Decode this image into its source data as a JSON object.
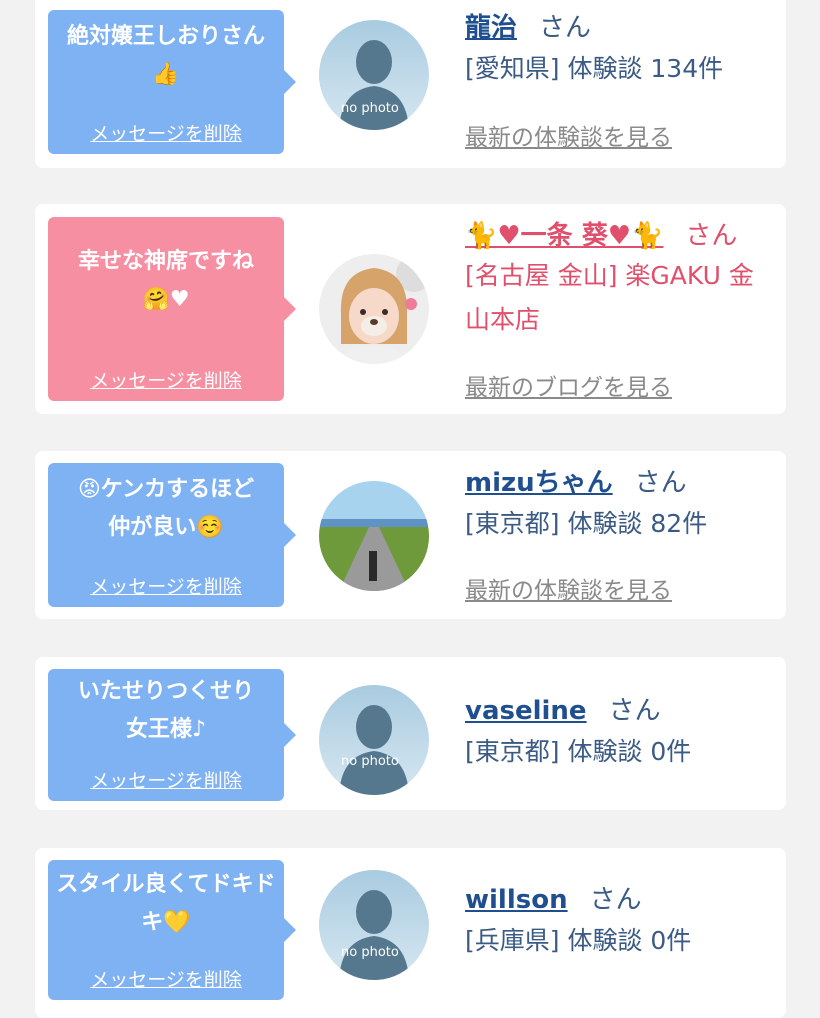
{
  "entries": [
    {
      "message": "絶対嬢王しおりさん👍",
      "delete_label": "メッセージを削除",
      "name": "龍治",
      "honorific": "さん",
      "meta": "[愛知県] 体験談 134件",
      "latest_link": "最新の体験談を見る",
      "avatar_label": "no photo"
    },
    {
      "message": "幸せな神席ですね\n🤗♥",
      "delete_label": "メッセージを削除",
      "name": "🐈♥一条 葵♥🐈",
      "honorific": "さん",
      "meta": "[名古屋 金山] 楽GAKU 金山本店",
      "latest_link": "最新のブログを見る"
    },
    {
      "message": "😡ケンカするほど\n仲が良い☺️",
      "delete_label": "メッセージを削除",
      "name": "mizuちゃん",
      "honorific": "さん",
      "meta": "[東京都] 体験談 82件",
      "latest_link": "最新の体験談を見る"
    },
    {
      "message": "いたせりつくせり\n女王様♪",
      "delete_label": "メッセージを削除",
      "name": "vaseline",
      "honorific": "さん",
      "meta": "[東京都] 体験談 0件",
      "avatar_label": "no photo"
    },
    {
      "message": "スタイル良くてドキドキ💛",
      "delete_label": "メッセージを削除",
      "name": "willson",
      "honorific": "さん",
      "meta": "[兵庫県] 体験談 0件",
      "avatar_label": "no photo"
    }
  ],
  "colors": {
    "bubble_blue": "#7fb2f2",
    "bubble_pink": "#f78fa3",
    "name_blue": "#1f4f8f",
    "name_pink": "#e0506c"
  }
}
